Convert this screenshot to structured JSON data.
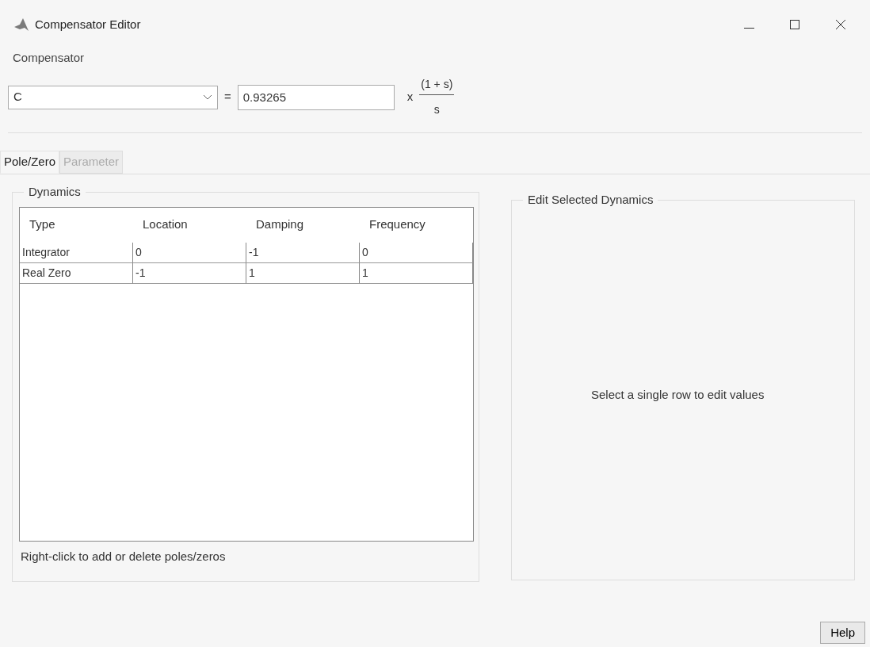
{
  "window": {
    "title": "Compensator Editor"
  },
  "compensator": {
    "label": "Compensator",
    "name": "C",
    "equals": "=",
    "gain": "0.93265",
    "times": "x",
    "numerator": "(1 + s)",
    "denominator": "s"
  },
  "tabs": [
    {
      "label": "Pole/Zero",
      "selected": true,
      "disabled": false
    },
    {
      "label": "Parameter",
      "selected": false,
      "disabled": true
    }
  ],
  "dynamics": {
    "title": "Dynamics",
    "columns": [
      "Type",
      "Location",
      "Damping",
      "Frequency"
    ],
    "rows": [
      {
        "cells": [
          "Integrator",
          "0",
          "-1",
          "0"
        ],
        "selected": false
      },
      {
        "cells": [
          "Real Zero",
          "-1",
          "1",
          "1"
        ],
        "selected": false
      }
    ],
    "hint": "Right-click to add or delete poles/zeros"
  },
  "edit": {
    "title": "Edit Selected Dynamics",
    "message": "Select a single row to edit values"
  },
  "buttons": [
    "Help"
  ]
}
